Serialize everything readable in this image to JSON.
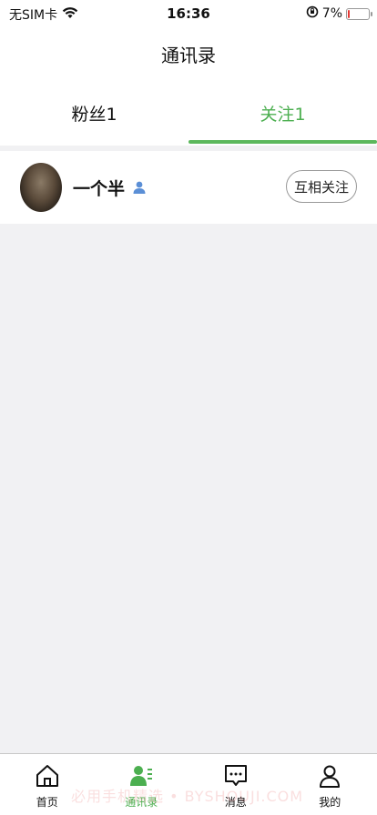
{
  "status_bar": {
    "carrier": "无SIM卡",
    "time": "16:36",
    "battery": "7%",
    "battery_level": 0.07
  },
  "nav": {
    "title": "通讯录"
  },
  "tabs": [
    {
      "label": "粉丝1",
      "active": false
    },
    {
      "label": "关注1",
      "active": true
    }
  ],
  "contacts": [
    {
      "name": "一个半",
      "action_label": "互相关注"
    }
  ],
  "tabbar": [
    {
      "label": "首页",
      "icon": "home-icon",
      "active": false
    },
    {
      "label": "通讯录",
      "icon": "contacts-icon",
      "active": true
    },
    {
      "label": "消息",
      "icon": "message-icon",
      "active": false
    },
    {
      "label": "我的",
      "icon": "profile-icon",
      "active": false
    }
  ],
  "watermark": "必用手机精选 • BYSHOUJI.COM",
  "colors": {
    "accent": "#4caf50",
    "badge": "#5b8fd6",
    "battery_low": "#e53935"
  }
}
